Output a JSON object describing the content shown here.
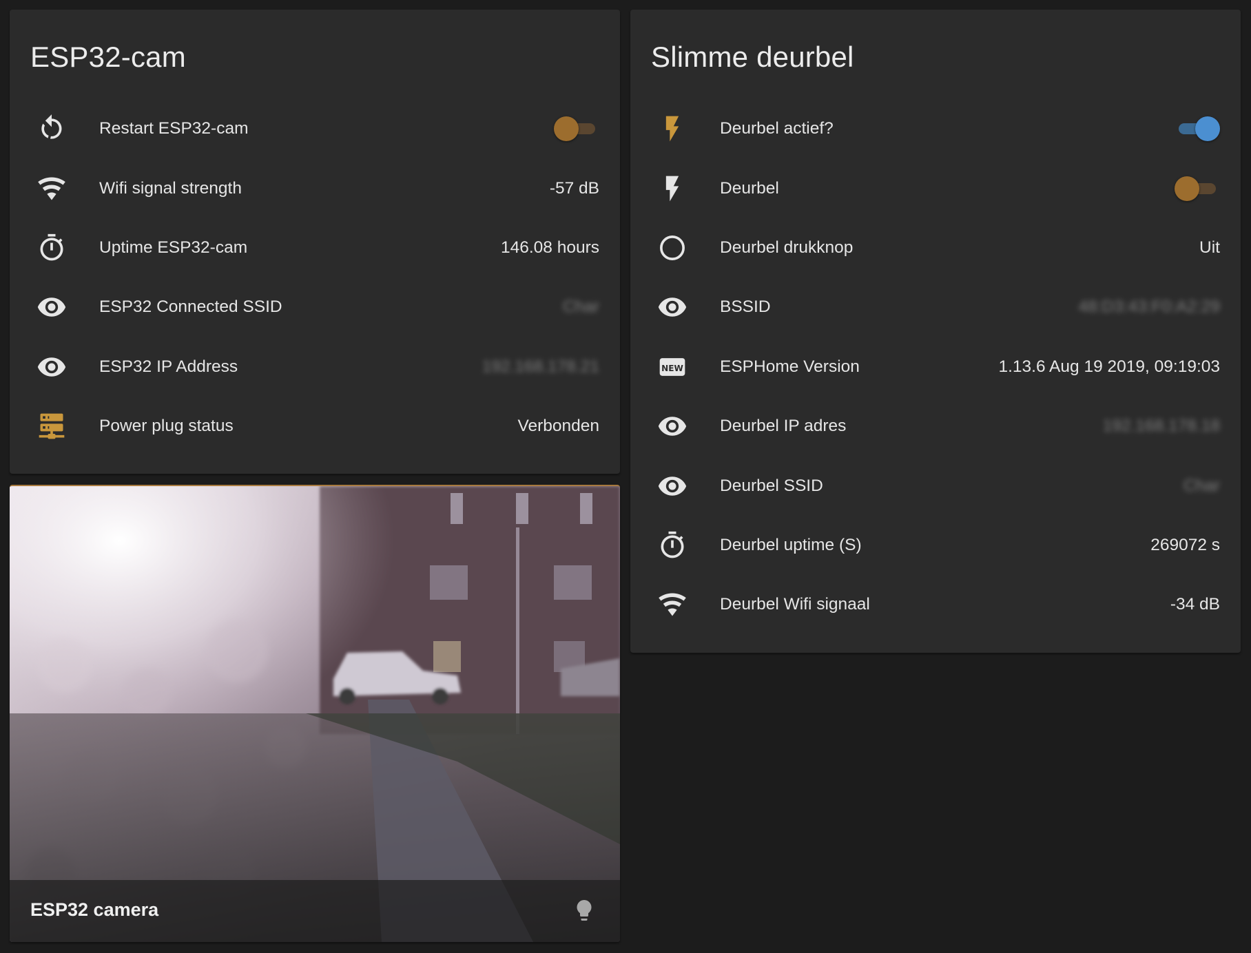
{
  "colors": {
    "background": "#1c1c1c",
    "card": "#2b2b2b",
    "accent_orange": "#9c6d2e",
    "accent_blue": "#4b8fd1",
    "icon_default": "#e6e6e6",
    "icon_active": "#c9973c"
  },
  "esp32_card": {
    "title": "ESP32-cam",
    "rows": [
      {
        "icon": "restart-icon",
        "label": "Restart ESP32-cam",
        "type": "toggle",
        "state": "off"
      },
      {
        "icon": "wifi-icon",
        "label": "Wifi signal strength",
        "value": "-57 dB"
      },
      {
        "icon": "timer-icon",
        "label": "Uptime ESP32-cam",
        "value": "146.08 hours"
      },
      {
        "icon": "eye-icon",
        "label": "ESP32 Connected SSID",
        "value": "Char",
        "blurred": true
      },
      {
        "icon": "eye-icon",
        "label": "ESP32 IP Address",
        "value": "192.168.178.21",
        "blurred": true
      },
      {
        "icon": "server-network-icon",
        "label": "Power plug status",
        "value": "Verbonden"
      }
    ]
  },
  "deurbel_card": {
    "title": "Slimme deurbel",
    "rows": [
      {
        "icon": "flash-icon",
        "label": "Deurbel actief?",
        "type": "toggle",
        "state": "on"
      },
      {
        "icon": "flash-icon",
        "label": "Deurbel",
        "type": "toggle",
        "state": "off"
      },
      {
        "icon": "circle-outline-icon",
        "label": "Deurbel drukknop",
        "value": "Uit"
      },
      {
        "icon": "eye-icon",
        "label": "BSSID",
        "value": "48:D3:43:F0:A2:29",
        "blurred": true
      },
      {
        "icon": "new-box-icon",
        "label": "ESPHome Version",
        "value": "1.13.6 Aug 19 2019, 09:19:03"
      },
      {
        "icon": "eye-icon",
        "label": "Deurbel IP adres",
        "value": "192.168.178.18",
        "blurred": true
      },
      {
        "icon": "eye-icon",
        "label": "Deurbel SSID",
        "value": "Char",
        "blurred": true
      },
      {
        "icon": "timer-icon",
        "label": "Deurbel uptime (S)",
        "value": "269072 s"
      },
      {
        "icon": "wifi-icon",
        "label": "Deurbel Wifi signaal",
        "value": "-34 dB"
      }
    ]
  },
  "camera_card": {
    "name": "ESP32 camera",
    "icon": "lightbulb-icon"
  }
}
